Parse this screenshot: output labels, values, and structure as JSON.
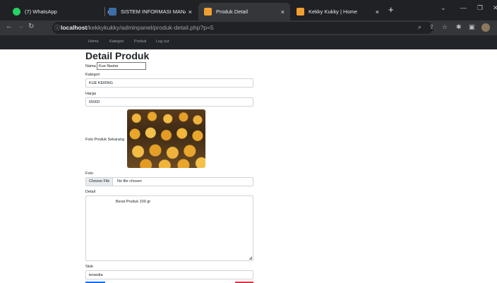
{
  "browser": {
    "tabs": [
      {
        "title": "(7) WhatsApp",
        "icon": "whatsapp-icon",
        "color": "#25d366",
        "close": "×"
      },
      {
        "title": "SISTEM INFORMASI MANAJEMI",
        "icon": "page-favicon-icon",
        "color": "#3c6ea8",
        "close": "×"
      },
      {
        "title": "Produk Detail",
        "icon": "page-favicon-icon",
        "color": "#f0a030",
        "close": "×"
      },
      {
        "title": "Kekky Kukky | Home",
        "icon": "page-favicon-icon",
        "color": "#f0a030",
        "close": "×"
      }
    ],
    "new_tab": "+",
    "url_host": "localhost",
    "url_path": "/kekkykukky/adminpanel/produk-detail.php?p=5"
  },
  "navbar": {
    "items": [
      "Home",
      "Kategori",
      "Produk",
      "Log out"
    ]
  },
  "page": {
    "title": "Detail Produk",
    "nama_label": "Nama",
    "nama_value": "Kue Nastar",
    "kategori_label": "Kategori",
    "kategori_value": "KUE KERING",
    "harga_label": "Harga",
    "harga_value": "65000",
    "foto_sekarang_label": "Foto Produk Sekarang",
    "foto_label": "Foto",
    "file_button": "Choose File",
    "file_status": "No file chosen",
    "detail_label": "Detail",
    "detail_value": "Berat Produk 100 gr",
    "stok_label": "Stok",
    "stok_value": "tersedia"
  },
  "colors": {
    "save_button": "#0d6efd",
    "delete_button": "#dc3545"
  }
}
